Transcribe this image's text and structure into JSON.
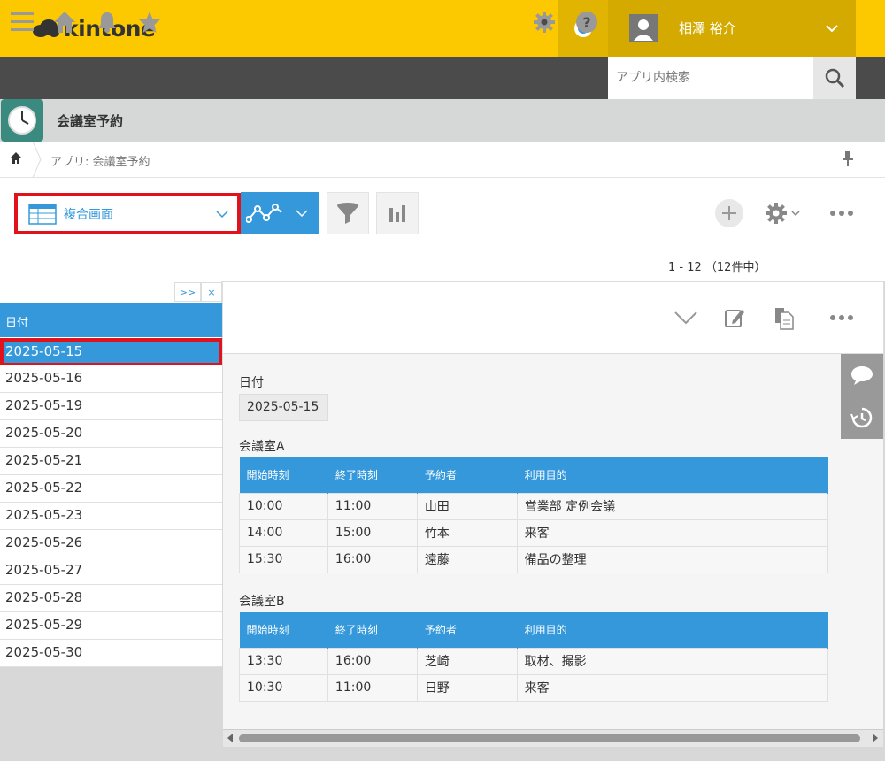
{
  "header": {
    "logo_text": "kintone",
    "user_name": "相澤 裕介",
    "brand_color": "#fcc800",
    "accent_color": "#3498db"
  },
  "navbar": {
    "icons": [
      "menu-icon",
      "home-icon",
      "bell-icon",
      "star-icon",
      "gear-icon",
      "help-icon"
    ],
    "search_placeholder": "アプリ内検索"
  },
  "app": {
    "title": "会議室予約",
    "breadcrumb": "アプリ: 会議室予約"
  },
  "toolbar": {
    "view_label": "複合画面",
    "record_count": "1 - 12 （12件中）"
  },
  "list": {
    "collapse_label": ">>",
    "close_label": "×",
    "column_header": "日付",
    "rows": [
      "2025-05-15",
      "2025-05-16",
      "2025-05-19",
      "2025-05-20",
      "2025-05-21",
      "2025-05-22",
      "2025-05-23",
      "2025-05-26",
      "2025-05-27",
      "2025-05-28",
      "2025-05-29",
      "2025-05-30"
    ],
    "selected_index": 0
  },
  "detail": {
    "date_label": "日付",
    "date_value": "2025-05-15",
    "room_a": {
      "label": "会議室A",
      "headers": [
        "開始時刻",
        "終了時刻",
        "予約者",
        "利用目的"
      ],
      "rows": [
        [
          "10:00",
          "11:00",
          "山田",
          "営業部 定例会議"
        ],
        [
          "14:00",
          "15:00",
          "竹本",
          "来客"
        ],
        [
          "15:30",
          "16:00",
          "遠藤",
          "備品の整理"
        ]
      ]
    },
    "room_b": {
      "label": "会議室B",
      "headers": [
        "開始時刻",
        "終了時刻",
        "予約者",
        "利用目的"
      ],
      "rows": [
        [
          "13:30",
          "16:00",
          "芝崎",
          "取材、撮影"
        ],
        [
          "10:30",
          "11:00",
          "日野",
          "来客"
        ]
      ]
    }
  }
}
